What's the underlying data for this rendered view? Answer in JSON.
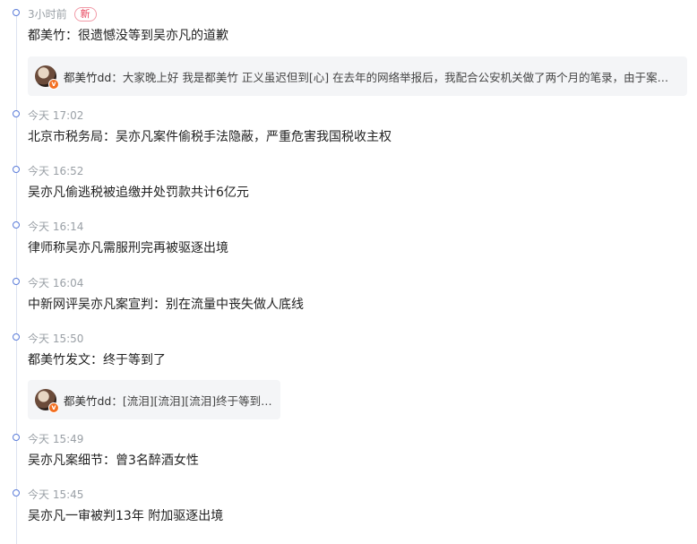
{
  "new_badge": "新",
  "items": [
    {
      "time": "3小时前",
      "title": "都美竹：很遗憾没等到吴亦凡的道歉",
      "quote": {
        "user": "都美竹dd",
        "sep": "：",
        "text": "大家晚上好 我是都美竹 正义虽迟但到[心] 在去年的网络举报后，我配合公安机关做了两个月的笔录，由于案…"
      }
    },
    {
      "time": "今天 17:02",
      "title": "北京市税务局：吴亦凡案件偷税手法隐蔽，严重危害我国税收主权"
    },
    {
      "time": "今天 16:52",
      "title": "吴亦凡偷逃税被追缴并处罚款共计6亿元"
    },
    {
      "time": "今天 16:14",
      "title": "律师称吴亦凡需服刑完再被驱逐出境"
    },
    {
      "time": "今天 16:04",
      "title": "中新网评吴亦凡案宣判：别在流量中丧失做人底线"
    },
    {
      "time": "今天 15:50",
      "title": "都美竹发文：终于等到了",
      "quote": {
        "user": "都美竹dd",
        "sep": "：",
        "text": "[流泪][流泪][流泪]终于等到了！"
      }
    },
    {
      "time": "今天 15:49",
      "title": "吴亦凡案细节：曾3名醉酒女性"
    },
    {
      "time": "今天 15:45",
      "title": "吴亦凡一审被判13年 附加驱逐出境"
    }
  ]
}
